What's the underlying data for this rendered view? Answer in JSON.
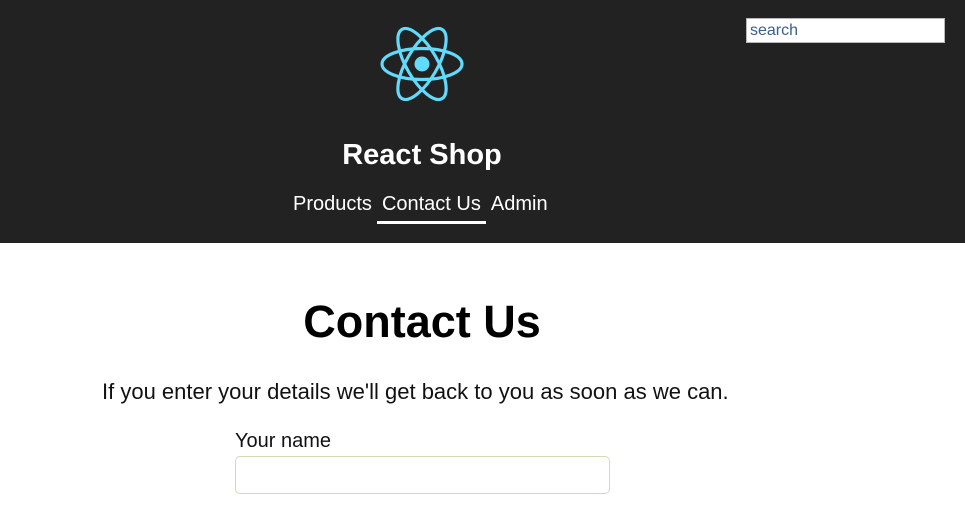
{
  "header": {
    "app_title": "React Shop",
    "logo_icon": "react-logo-icon",
    "logo_color": "#61dafb",
    "background_color": "#222222",
    "search": {
      "placeholder": "search",
      "value": ""
    },
    "nav": [
      {
        "label": "Products",
        "active": false
      },
      {
        "label": "Contact Us",
        "active": true
      },
      {
        "label": "Admin",
        "active": false
      }
    ]
  },
  "main": {
    "heading": "Contact Us",
    "intro": "If you enter your details we'll get back to you as soon as we can.",
    "form": {
      "name_label": "Your name",
      "name_value": ""
    }
  }
}
